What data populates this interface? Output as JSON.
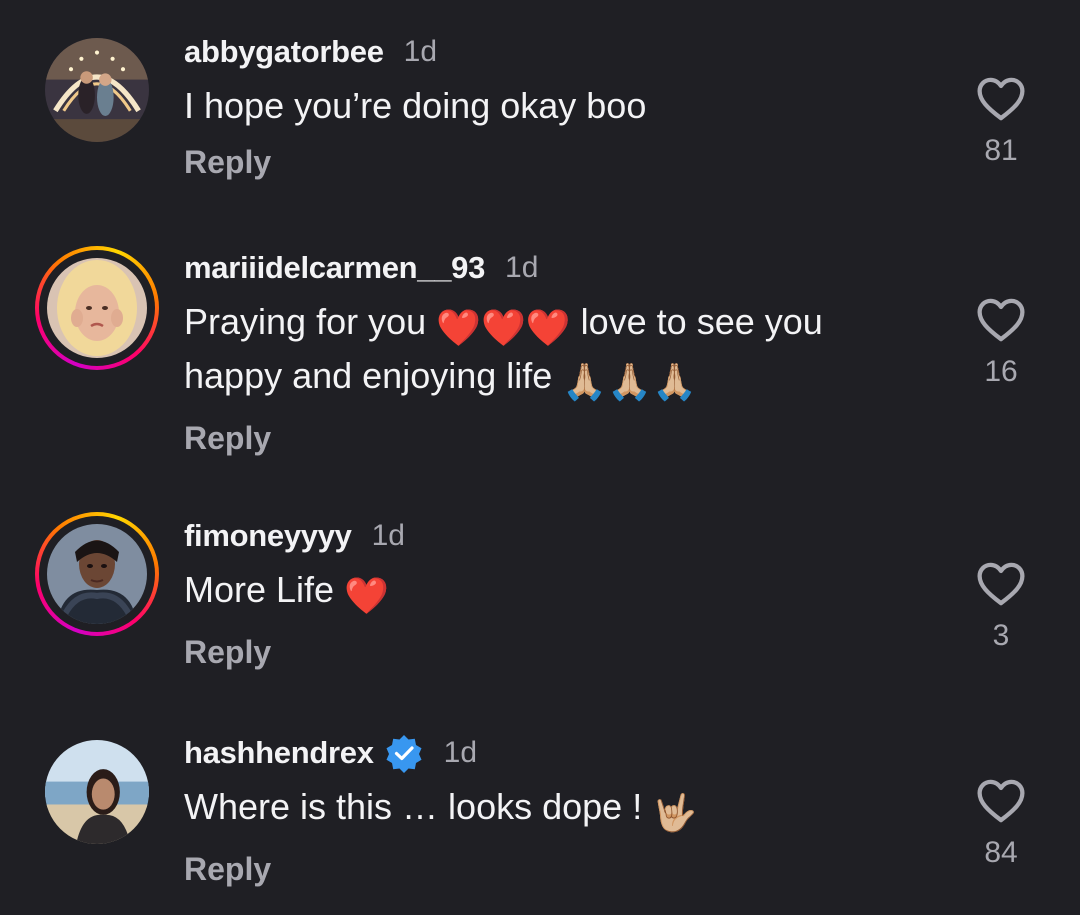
{
  "comments": [
    {
      "username": "abbygatorbee",
      "time": "1d",
      "text": "I hope you’re doing okay boo",
      "emoji": "",
      "reply_label": "Reply",
      "likes": "81",
      "verified": false,
      "story_ring": false
    },
    {
      "username": "mariiidelcarmen__93",
      "time": "1d",
      "text_a": "Praying for you",
      "emoji_a": "❤️❤️❤️",
      "text_b": "love to see you",
      "text_c": "happy and enjoying life",
      "emoji_b": "🙏🏼🙏🏼🙏🏼",
      "reply_label": "Reply",
      "likes": "16",
      "verified": false,
      "story_ring": true
    },
    {
      "username": "fimoneyyyy",
      "time": "1d",
      "text": "More Life",
      "emoji": "❤️",
      "reply_label": "Reply",
      "likes": "3",
      "verified": false,
      "story_ring": true
    },
    {
      "username": "hashhendrex",
      "time": "1d",
      "text": "Where is this … looks dope !",
      "emoji": "🤟🏼",
      "reply_label": "Reply",
      "likes": "84",
      "verified": true,
      "story_ring": false
    }
  ],
  "colors": {
    "background": "#1f1f24",
    "primary_text": "#f3f3f5",
    "secondary_text": "#a8a8b0",
    "verified_blue": "#3897f0",
    "heart_red": "#ff3040"
  },
  "icons": {
    "like": "heart-outline-icon",
    "verified": "verified-badge-icon",
    "avatar": "profile-photo"
  }
}
